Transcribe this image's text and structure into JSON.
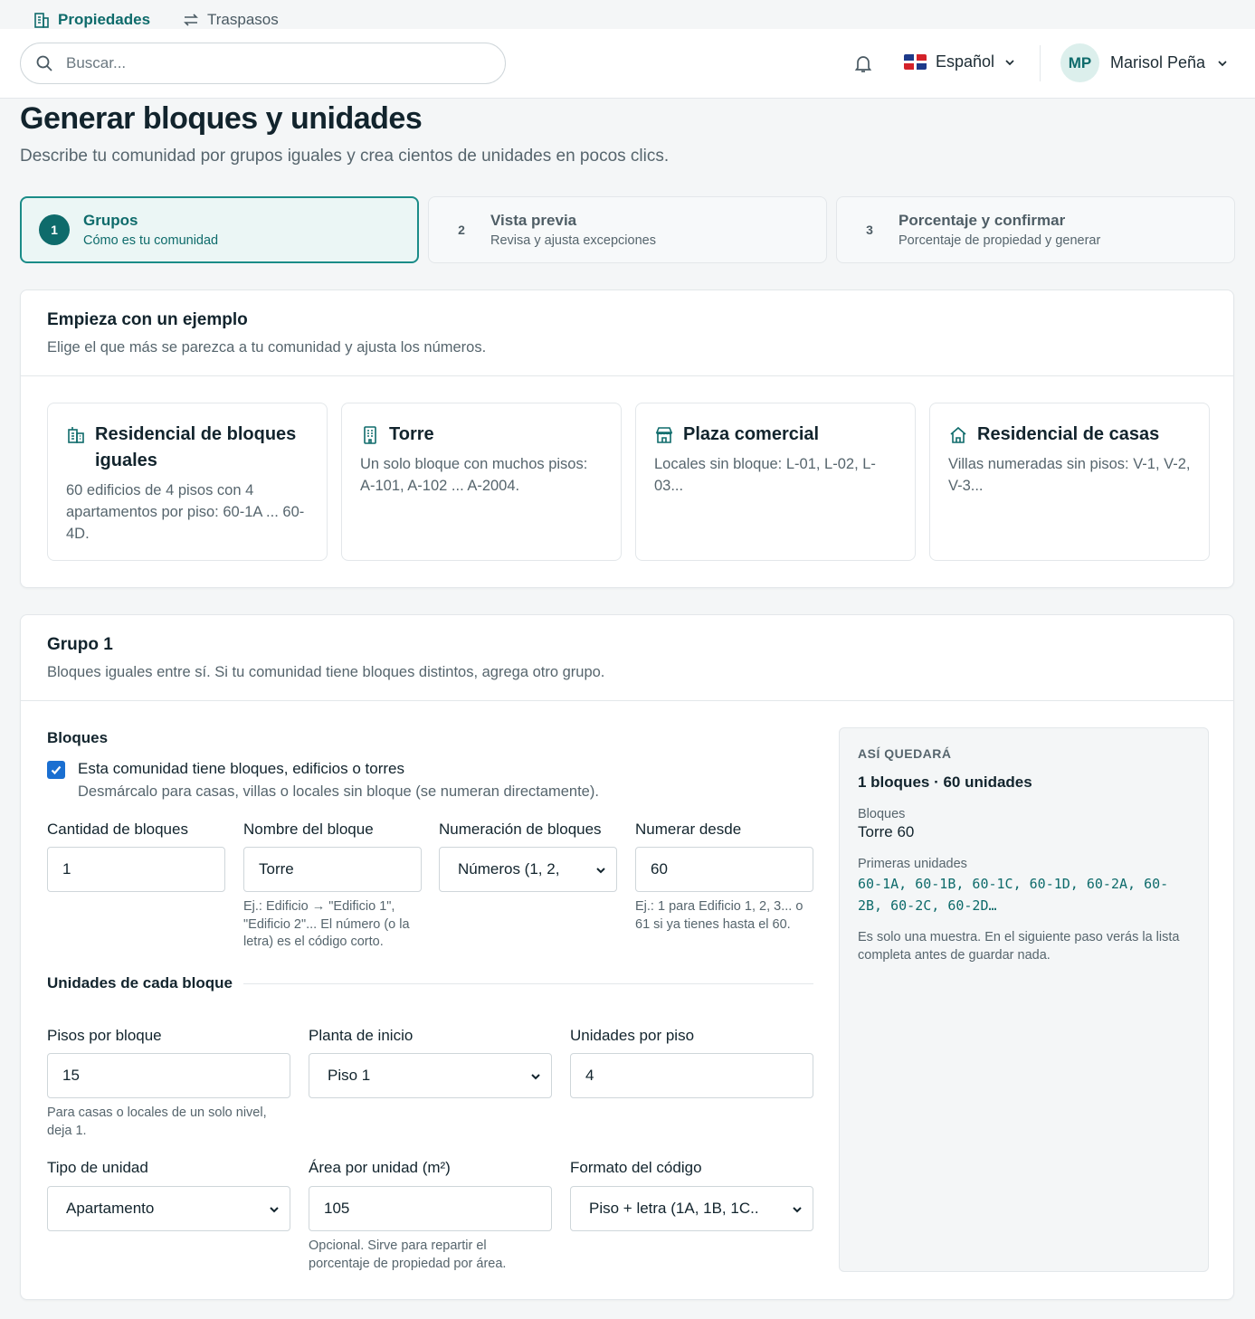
{
  "subnav": {
    "items": [
      {
        "label": "Propiedades",
        "icon": "building-icon",
        "active": true
      },
      {
        "label": "Traspasos",
        "icon": "swap-icon",
        "active": false
      }
    ]
  },
  "topbar": {
    "search_placeholder": "Buscar...",
    "language": "Español",
    "user": {
      "initials": "MP",
      "name": "Marisol Peña"
    }
  },
  "page": {
    "title": "Generar bloques y unidades",
    "subtitle": "Describe tu comunidad por grupos iguales y crea cientos de unidades en pocos clics."
  },
  "steps": [
    {
      "number": "1",
      "title": "Grupos",
      "desc": "Cómo es tu comunidad",
      "active": true
    },
    {
      "number": "2",
      "title": "Vista previa",
      "desc": "Revisa y ajusta excepciones",
      "active": false
    },
    {
      "number": "3",
      "title": "Porcentaje y confirmar",
      "desc": "Porcentaje de propiedad y generar",
      "active": false
    }
  ],
  "examples": {
    "title": "Empieza con un ejemplo",
    "subtitle": "Elige el que más se parezca a tu comunidad y ajusta los números.",
    "templates": [
      {
        "title": "Residencial de bloques iguales",
        "desc": "60 edificios de 4 pisos con 4 apartamentos por piso: 60-1A ... 60-4D.",
        "icon": "buildings-icon"
      },
      {
        "title": "Torre",
        "desc": "Un solo bloque con muchos pisos: A-101, A-102 ... A-2004.",
        "icon": "tower-icon"
      },
      {
        "title": "Plaza comercial",
        "desc": "Locales sin bloque: L-01, L-02, L-03...",
        "icon": "store-icon"
      },
      {
        "title": "Residencial de casas",
        "desc": "Villas numeradas sin pisos: V-1, V-2, V-3...",
        "icon": "house-icon"
      }
    ]
  },
  "group": {
    "title": "Grupo 1",
    "subtitle": "Bloques iguales entre sí. Si tu comunidad tiene bloques distintos, agrega otro grupo.",
    "blocks_section": "Bloques",
    "has_blocks": {
      "checked": true,
      "label": "Esta comunidad tiene bloques, edificios o torres",
      "desc": "Desmárcalo para casas, villas o locales sin bloque (se numeran directamente)."
    },
    "fields": {
      "block_count": {
        "label": "Cantidad de bloques",
        "value": "1"
      },
      "block_name": {
        "label": "Nombre del bloque",
        "value": "Torre",
        "hint": "Ej.: Edificio → \"Edificio 1\", \"Edificio 2\"... El número (o la letra) es el código corto."
      },
      "block_numbering": {
        "label": "Numeración de bloques",
        "value": "Números (1, 2,"
      },
      "number_from": {
        "label": "Numerar desde",
        "value": "60",
        "hint": "Ej.: 1 para Edificio 1, 2, 3... o 61 si ya tienes hasta el 60."
      }
    },
    "units_section": "Unidades de cada bloque",
    "unit_fields": {
      "floors": {
        "label": "Pisos por bloque",
        "value": "15",
        "hint": "Para casas o locales de un solo nivel, deja 1."
      },
      "start_floor": {
        "label": "Planta de inicio",
        "value": "Piso 1"
      },
      "units_per_floor": {
        "label": "Unidades por piso",
        "value": "4"
      },
      "unit_type": {
        "label": "Tipo de unidad",
        "value": "Apartamento"
      },
      "area": {
        "label": "Área por unidad (m²)",
        "value": "105",
        "hint": "Opcional. Sirve para repartir el porcentaje de propiedad por área."
      },
      "code_format": {
        "label": "Formato del código",
        "value": "Piso + letra (1A, 1B, 1C.."
      }
    },
    "preview": {
      "eyebrow": "ASÍ QUEDARÁ",
      "summary": "1 bloques · 60 unidades",
      "blocks_label": "Bloques",
      "blocks_value": "Torre 60",
      "units_label": "Primeras unidades",
      "units_value": "60-1A, 60-1B, 60-1C, 60-1D, 60-2A, 60-2B, 60-2C, 60-2D…",
      "note": "Es solo una muestra. En el siguiente paso verás la lista completa antes de guardar nada."
    }
  },
  "colors": {
    "accent": "#0e6b6b",
    "accent_border": "#1a8c88",
    "checkbox": "#1a6fd1"
  }
}
